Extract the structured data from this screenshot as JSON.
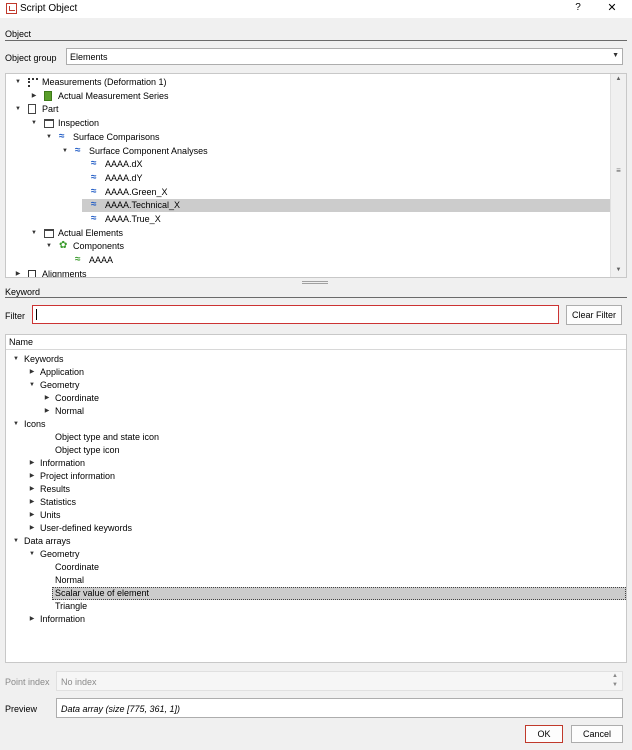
{
  "window": {
    "title": "Script Object",
    "help": "?",
    "close": "✕"
  },
  "object_section": {
    "label": "Object",
    "group_label": "Object group",
    "group_value": "Elements",
    "tree": [
      {
        "label": "Measurements (Deformation 1)",
        "icon": "measurement-icon",
        "expander": "down"
      },
      {
        "label": "Actual Measurement Series",
        "icon": "measurement-series-icon",
        "expander": "right"
      },
      {
        "label": "Part",
        "icon": "part-icon",
        "expander": "down"
      },
      {
        "label": "Inspection",
        "icon": "folder-icon",
        "expander": "down"
      },
      {
        "label": "Surface Comparisons",
        "icon": "surface-comparison-icon",
        "expander": "down"
      },
      {
        "label": "Surface Component Analyses",
        "icon": "surface-comparison-icon",
        "expander": "down"
      },
      {
        "label": "AAAA.dX",
        "icon": "surface-comparison-icon"
      },
      {
        "label": "AAAA.dY",
        "icon": "surface-comparison-icon"
      },
      {
        "label": "AAAA.Green_X",
        "icon": "surface-comparison-icon"
      },
      {
        "label": "AAAA.Technical_X",
        "icon": "surface-comparison-icon",
        "selected": true
      },
      {
        "label": "AAAA.True_X",
        "icon": "surface-comparison-icon"
      },
      {
        "label": "Actual Elements",
        "icon": "folder-icon",
        "expander": "down"
      },
      {
        "label": "Components",
        "icon": "components-icon",
        "expander": "down"
      },
      {
        "label": "AAAA",
        "icon": "surface-element-icon"
      },
      {
        "label": "Alignments",
        "icon": "alignment-icon",
        "expander": "right"
      }
    ]
  },
  "keyword_section": {
    "label": "Keyword",
    "filter_label": "Filter",
    "filter_value": "",
    "clear_filter": "Clear Filter",
    "column_name": "Name",
    "tree": [
      {
        "label": "Keywords",
        "expander": "down"
      },
      {
        "label": "Application",
        "expander": "right"
      },
      {
        "label": "Geometry",
        "expander": "down"
      },
      {
        "label": "Coordinate",
        "expander": "right"
      },
      {
        "label": "Normal",
        "expander": "right"
      },
      {
        "label": "Icons",
        "expander": "down"
      },
      {
        "label": "Object type and state icon"
      },
      {
        "label": "Object type icon"
      },
      {
        "label": "Information",
        "expander": "right"
      },
      {
        "label": "Project information",
        "expander": "right"
      },
      {
        "label": "Results",
        "expander": "right"
      },
      {
        "label": "Statistics",
        "expander": "right"
      },
      {
        "label": "Units",
        "expander": "right"
      },
      {
        "label": "User-defined keywords",
        "expander": "right"
      },
      {
        "label": "Data arrays",
        "expander": "down"
      },
      {
        "label": "Geometry",
        "expander": "down"
      },
      {
        "label": "Coordinate"
      },
      {
        "label": "Normal"
      },
      {
        "label": "Scalar value of element",
        "selected": true
      },
      {
        "label": "Triangle"
      },
      {
        "label": "Information",
        "expander": "right"
      }
    ]
  },
  "point_index": {
    "label": "Point index",
    "value": "No index"
  },
  "preview": {
    "label": "Preview",
    "value": "Data array (size [775, 361, 1])"
  },
  "buttons": {
    "ok": "OK",
    "cancel": "Cancel"
  },
  "colors": {
    "selection": "#cccccc",
    "accent": "#c0392b",
    "tree_icon_blue": "#1f5bc5",
    "tree_icon_green": "#3a9b2c"
  }
}
